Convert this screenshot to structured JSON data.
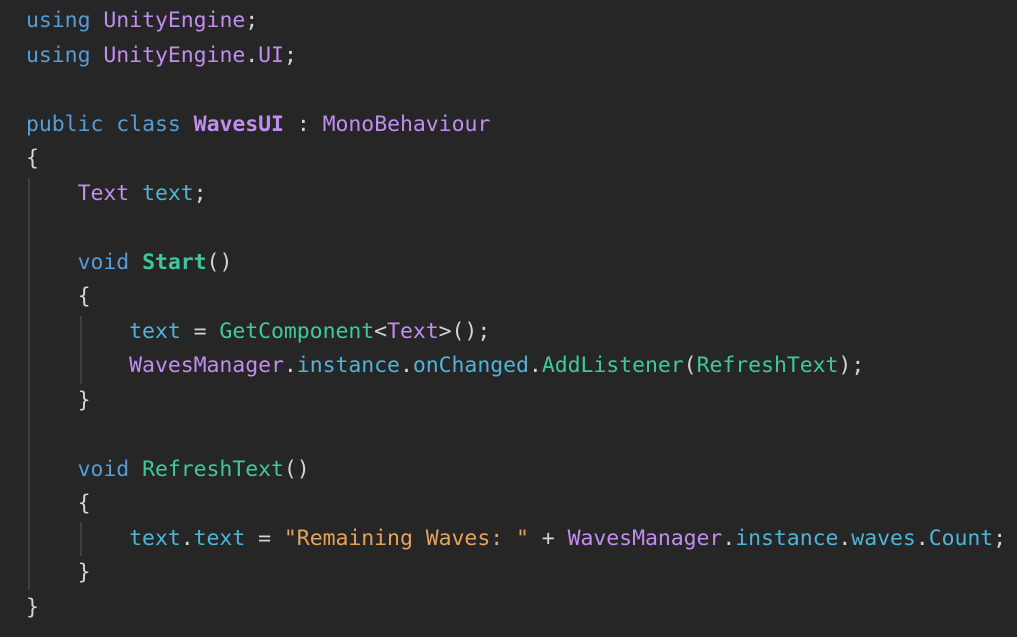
{
  "editor": {
    "language": "csharp",
    "lines": [
      {
        "tokens": [
          {
            "t": "using",
            "c": "kw"
          },
          {
            "t": " ",
            "c": "punc"
          },
          {
            "t": "UnityEngine",
            "c": "type"
          },
          {
            "t": ";",
            "c": "punc"
          }
        ]
      },
      {
        "tokens": [
          {
            "t": "using",
            "c": "kw"
          },
          {
            "t": " ",
            "c": "punc"
          },
          {
            "t": "UnityEngine",
            "c": "type"
          },
          {
            "t": ".",
            "c": "punc"
          },
          {
            "t": "UI",
            "c": "type"
          },
          {
            "t": ";",
            "c": "punc"
          }
        ]
      },
      {
        "tokens": []
      },
      {
        "tokens": [
          {
            "t": "public",
            "c": "kw"
          },
          {
            "t": " ",
            "c": "punc"
          },
          {
            "t": "class",
            "c": "kw"
          },
          {
            "t": " ",
            "c": "punc"
          },
          {
            "t": "WavesUI",
            "c": "cls"
          },
          {
            "t": " : ",
            "c": "punc"
          },
          {
            "t": "MonoBehaviour",
            "c": "type"
          }
        ]
      },
      {
        "tokens": [
          {
            "t": "{",
            "c": "brace"
          }
        ]
      },
      {
        "tokens": [
          {
            "t": "    ",
            "c": "punc"
          },
          {
            "t": "Text",
            "c": "type"
          },
          {
            "t": " ",
            "c": "punc"
          },
          {
            "t": "text",
            "c": "var"
          },
          {
            "t": ";",
            "c": "punc"
          }
        ]
      },
      {
        "tokens": []
      },
      {
        "tokens": [
          {
            "t": "    ",
            "c": "punc"
          },
          {
            "t": "void",
            "c": "kw"
          },
          {
            "t": " ",
            "c": "punc"
          },
          {
            "t": "Start",
            "c": "fnb"
          },
          {
            "t": "()",
            "c": "punc"
          }
        ]
      },
      {
        "tokens": [
          {
            "t": "    ",
            "c": "punc"
          },
          {
            "t": "{",
            "c": "brace"
          }
        ]
      },
      {
        "tokens": [
          {
            "t": "        ",
            "c": "punc"
          },
          {
            "t": "text",
            "c": "var"
          },
          {
            "t": " = ",
            "c": "punc"
          },
          {
            "t": "GetComponent",
            "c": "fn"
          },
          {
            "t": "<",
            "c": "punc"
          },
          {
            "t": "Text",
            "c": "type"
          },
          {
            "t": ">();",
            "c": "punc"
          }
        ]
      },
      {
        "tokens": [
          {
            "t": "        ",
            "c": "punc"
          },
          {
            "t": "WavesManager",
            "c": "type"
          },
          {
            "t": ".",
            "c": "punc"
          },
          {
            "t": "instance",
            "c": "var"
          },
          {
            "t": ".",
            "c": "punc"
          },
          {
            "t": "onChanged",
            "c": "var"
          },
          {
            "t": ".",
            "c": "punc"
          },
          {
            "t": "AddListener",
            "c": "fn"
          },
          {
            "t": "(",
            "c": "punc"
          },
          {
            "t": "RefreshText",
            "c": "fn"
          },
          {
            "t": ");",
            "c": "punc"
          }
        ]
      },
      {
        "tokens": [
          {
            "t": "    ",
            "c": "punc"
          },
          {
            "t": "}",
            "c": "brace"
          }
        ]
      },
      {
        "tokens": []
      },
      {
        "tokens": [
          {
            "t": "    ",
            "c": "punc"
          },
          {
            "t": "void",
            "c": "kw"
          },
          {
            "t": " ",
            "c": "punc"
          },
          {
            "t": "RefreshText",
            "c": "fn"
          },
          {
            "t": "()",
            "c": "punc"
          }
        ]
      },
      {
        "tokens": [
          {
            "t": "    ",
            "c": "punc"
          },
          {
            "t": "{",
            "c": "brace"
          }
        ]
      },
      {
        "tokens": [
          {
            "t": "        ",
            "c": "punc"
          },
          {
            "t": "text",
            "c": "var"
          },
          {
            "t": ".",
            "c": "punc"
          },
          {
            "t": "text",
            "c": "var"
          },
          {
            "t": " = ",
            "c": "punc"
          },
          {
            "t": "\"Remaining Waves: \"",
            "c": "str"
          },
          {
            "t": " + ",
            "c": "punc"
          },
          {
            "t": "WavesManager",
            "c": "type"
          },
          {
            "t": ".",
            "c": "punc"
          },
          {
            "t": "instance",
            "c": "var"
          },
          {
            "t": ".",
            "c": "punc"
          },
          {
            "t": "waves",
            "c": "var"
          },
          {
            "t": ".",
            "c": "punc"
          },
          {
            "t": "Count",
            "c": "var"
          },
          {
            "t": ";",
            "c": "punc"
          }
        ]
      },
      {
        "tokens": [
          {
            "t": "    ",
            "c": "punc"
          },
          {
            "t": "}",
            "c": "brace"
          }
        ]
      },
      {
        "tokens": [
          {
            "t": "}",
            "c": "brace"
          }
        ]
      }
    ]
  }
}
